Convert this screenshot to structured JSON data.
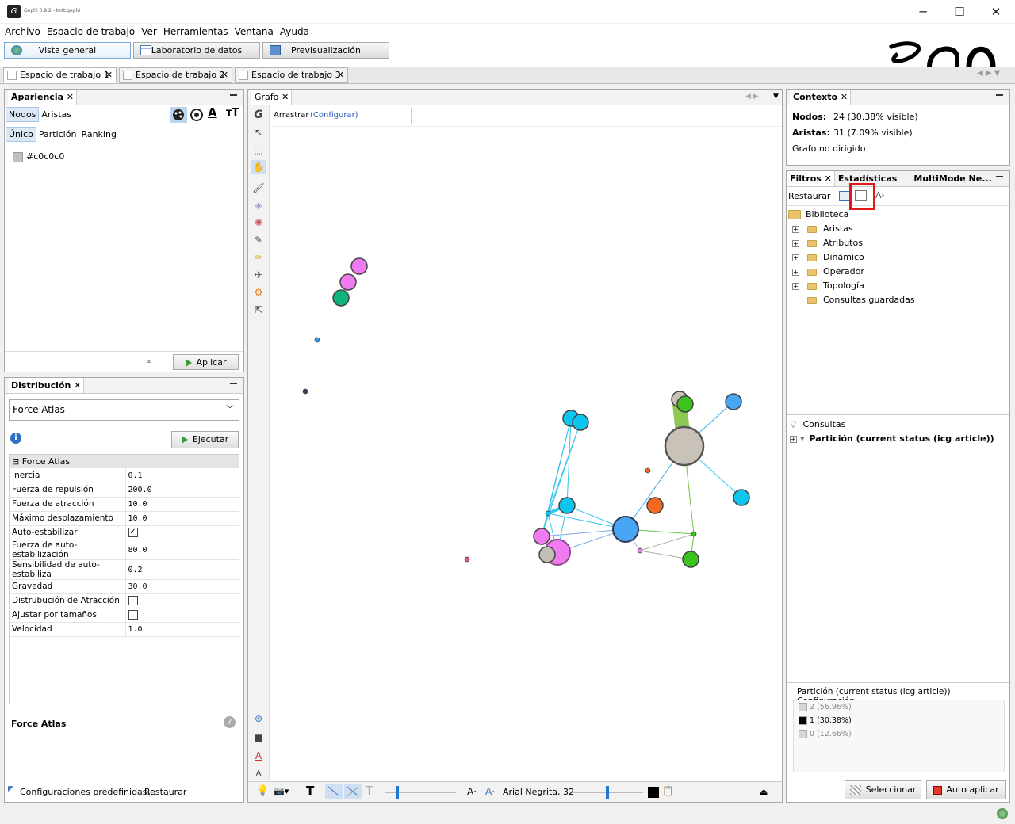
{
  "window": {
    "title": "Gephi 0.9.2 - test.gephi",
    "minimize": "─",
    "maximize": "☐",
    "close": "✕"
  },
  "menu": [
    "Archivo",
    "Espacio de trabajo",
    "Ver",
    "Herramientas",
    "Ventana",
    "Ayuda"
  ],
  "modes": {
    "overview": "Vista general",
    "datalab": "Laboratorio de datos",
    "preview": "Previsualización"
  },
  "workspaces": [
    "Espacio de trabajo 1",
    "Espacio de trabajo 2",
    "Espacio de trabajo 3"
  ],
  "appearance": {
    "title": "Apariencia",
    "tabs": [
      "Nodos",
      "Aristas"
    ],
    "subtabs": [
      "Único",
      "Partición",
      "Ranking"
    ],
    "color_value": "#c0c0c0",
    "apply": "Aplicar"
  },
  "layout": {
    "title": "Distribución",
    "algorithm": "Force Atlas",
    "run": "Ejecutar",
    "section": "Force Atlas",
    "props": [
      {
        "name": "Inercia",
        "value": "0.1"
      },
      {
        "name": "Fuerza de repulsión",
        "value": "200.0"
      },
      {
        "name": "Fuerza de atracción",
        "value": "10.0"
      },
      {
        "name": "Máximo desplazamiento",
        "value": "10.0"
      },
      {
        "name": "Auto-estabilizar",
        "value": "✓"
      },
      {
        "name": "Fuerza de auto-estabilización",
        "value": "80.0"
      },
      {
        "name": "Sensibilidad de auto-estabiliza",
        "value": "0.2"
      },
      {
        "name": "Gravedad",
        "value": "30.0"
      },
      {
        "name": "Distrubución de Atracción",
        "value": ""
      },
      {
        "name": "Ajustar por tamaños",
        "value": ""
      },
      {
        "name": "Velocidad",
        "value": "1.0"
      }
    ],
    "desc_title": "Force Atlas",
    "presets": "Configuraciones predefinidas...",
    "reset": "Restaurar"
  },
  "graph": {
    "title": "Grafo",
    "drag_label": "Arrastrar",
    "configure": "(Configurar)",
    "font_label": "Arial Negrita, 32"
  },
  "context": {
    "title": "Contexto",
    "nodes_label": "Nodos:",
    "nodes_value": "24 (30.38% visible)",
    "edges_label": "Aristas:",
    "edges_value": "31 (7.09% visible)",
    "graph_type": "Grafo no dirigido"
  },
  "filters": {
    "tabs": [
      "Filtros",
      "Estadísticas",
      "MultiMode Ne..."
    ],
    "reset": "Restaurar",
    "library": "Biblioteca",
    "folders": [
      "Aristas",
      "Atributos",
      "Dinámico",
      "Operador",
      "Topología"
    ],
    "saved": "Consultas guardadas",
    "queries": "Consultas",
    "query_item": "Partición (current status (icg article))",
    "config_title": "Partición (current status (icg article)) Configuración",
    "legend": [
      {
        "label": "2 (56.96%)",
        "color": "#d6d6d6"
      },
      {
        "label": "1 (30.38%)",
        "color": "#000000"
      },
      {
        "label": "0 (12.66%)",
        "color": "#d6d6d6"
      }
    ],
    "select": "Seleccionar",
    "auto_apply": "Auto aplicar"
  }
}
